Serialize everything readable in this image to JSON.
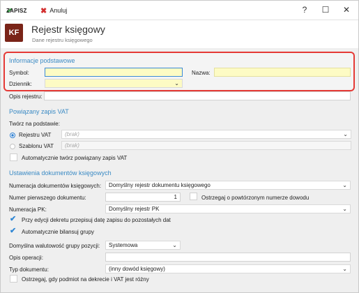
{
  "toolbar": {
    "save_label": "ZAPISZ",
    "cancel_label": "Anuluj",
    "help_label": "?",
    "maximize_label": "☐",
    "close_label": "✕"
  },
  "header": {
    "badge": "KF",
    "title": "Rejestr księgowy",
    "subtitle": "Dane rejestru księgowego"
  },
  "basic": {
    "title": "Informacje podstawowe",
    "symbol_label": "Symbol:",
    "symbol_value": "",
    "name_label": "Nazwa:",
    "name_value": "",
    "journal_label": "Dziennik:",
    "journal_value": "",
    "description_label": "Opis rejestru:",
    "description_value": ""
  },
  "vat": {
    "title": "Powiązany zapis VAT",
    "create_on_label": "Twórz na podstawie:",
    "register_vat_label": "Rejestru VAT",
    "register_vat_placeholder": "(brak)",
    "template_vat_label": "Szablonu VAT",
    "template_vat_placeholder": "(brak)",
    "auto_create_label": "Automatycznie twórz powiązany zapis VAT"
  },
  "settings": {
    "title": "Ustawienia dokumentów księgowych",
    "numbering_label": "Numeracja dokumentów księgowych:",
    "numbering_value": "Domyślny rejestr dokumentu księgowego",
    "first_number_label": "Numer pierwszego dokumentu:",
    "first_number_value": "1",
    "warn_duplicate_label": "Ostrzegaj o powtórzonym numerze dowodu",
    "pk_numbering_label": "Numeracja PK:",
    "pk_numbering_value": "Domyślny rejestr PK",
    "copy_date_label": "Przy edycji dekretu przepisuj datę zapisu do pozostałych dat",
    "auto_balance_label": "Automatycznie bilansuj grupy",
    "default_currency_label": "Domyślna walutowość grupy pozycji:",
    "default_currency_value": "Systemowa",
    "operation_desc_label": "Opis operacji:",
    "operation_desc_value": "",
    "doc_type_label": "Typ dokumentu:",
    "doc_type_value": "(inny dowód księgowy)",
    "warn_vat_label": "Ostrzegaj, gdy podmiot na dekrecie i VAT jest różny"
  }
}
